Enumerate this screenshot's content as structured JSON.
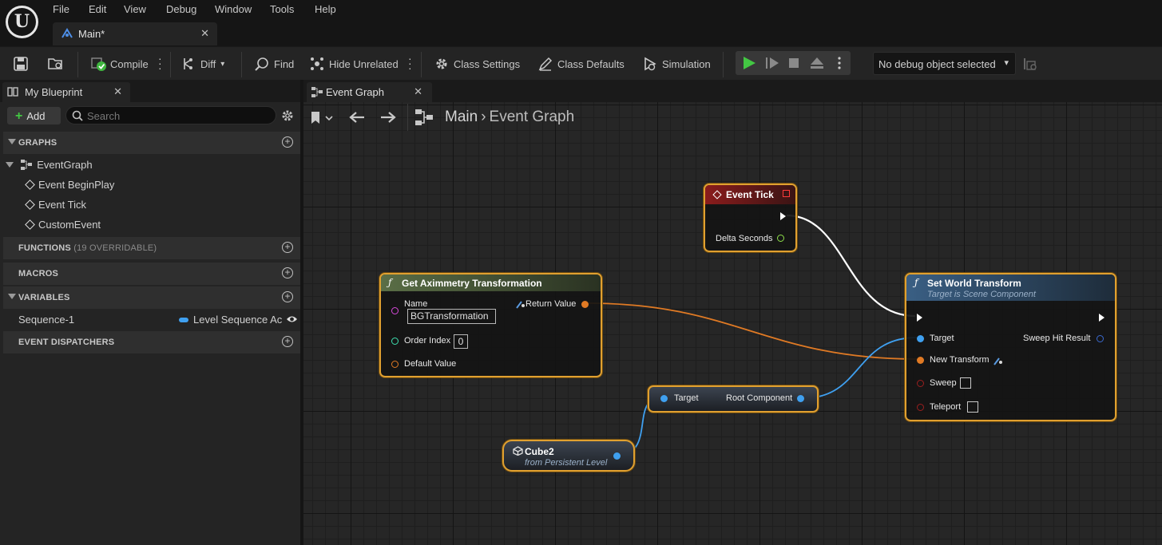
{
  "app": {
    "logo_letter": "U",
    "menu": [
      "File",
      "Edit",
      "View",
      "Debug",
      "Window",
      "Tools",
      "Help"
    ],
    "document_tab": "Main*"
  },
  "toolbar": {
    "compile": "Compile",
    "diff": "Diff",
    "find": "Find",
    "hide_unrelated": "Hide Unrelated",
    "class_settings": "Class Settings",
    "class_defaults": "Class Defaults",
    "simulation": "Simulation",
    "debug_object": "No debug object selected"
  },
  "my_blueprint": {
    "tab_title": "My Blueprint",
    "add_label": "Add",
    "search_placeholder": "Search",
    "sections": {
      "graphs": "GRAPHS",
      "functions": "FUNCTIONS",
      "functions_sub": "(19 OVERRIDABLE)",
      "macros": "MACROS",
      "variables": "VARIABLES",
      "event_dispatchers": "EVENT DISPATCHERS"
    },
    "graph_tree": {
      "root": "EventGraph",
      "children": [
        "Event BeginPlay",
        "Event Tick",
        "CustomEvent"
      ]
    },
    "variables": [
      {
        "name": "Sequence-1",
        "type": "Level Sequence Ac",
        "type_color": "#3fa0f0"
      }
    ]
  },
  "graph": {
    "tab_title": "Event Graph",
    "breadcrumb": [
      "Main",
      "Event Graph"
    ],
    "nodes": {
      "event_tick": {
        "title": "Event Tick",
        "header_color": "#7a1818",
        "pins": {
          "delta_seconds": "Delta Seconds"
        }
      },
      "get_aximmetry": {
        "title": "Get Aximmetry Transformation",
        "header_color": "#4a5a3a",
        "pins": {
          "name": "Name",
          "name_value": "BGTransformation",
          "order_index": "Order Index",
          "order_index_value": "0",
          "default_value": "Default Value",
          "return_value": "Return Value"
        }
      },
      "set_world_transform": {
        "title": "Set World Transform",
        "subtitle": "Target is Scene Component",
        "header_color": "#2a4a6a",
        "pins": {
          "target": "Target",
          "new_transform": "New Transform",
          "sweep": "Sweep",
          "teleport": "Teleport",
          "sweep_hit_result": "Sweep Hit Result"
        }
      },
      "get_root_component": {
        "target": "Target",
        "output": "Root Component"
      },
      "cube2": {
        "title": "Cube2",
        "subtitle": "from Persistent Level"
      }
    },
    "pin_colors": {
      "exec": "#ffffff",
      "float": "#8ee04a",
      "object": "#3fa0f0",
      "struct": "#f07a24",
      "name": "#d84adc",
      "int": "#3ee0b0",
      "bool": "#9a1f1f"
    }
  }
}
